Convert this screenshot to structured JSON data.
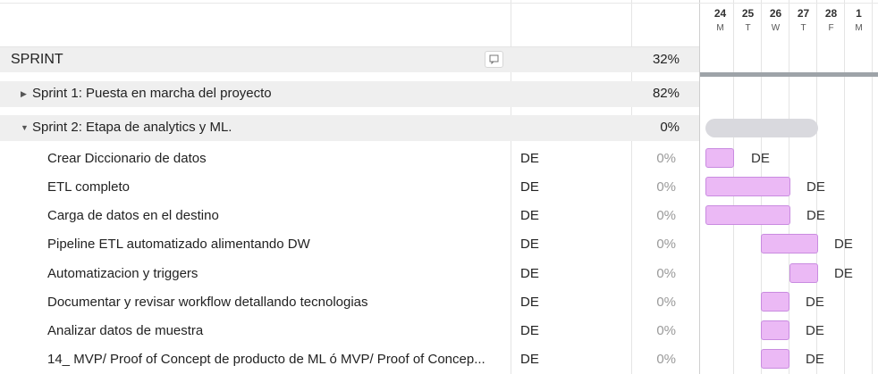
{
  "timeline": {
    "days": [
      {
        "num": "24",
        "dow": "M"
      },
      {
        "num": "25",
        "dow": "T"
      },
      {
        "num": "26",
        "dow": "W"
      },
      {
        "num": "27",
        "dow": "T"
      },
      {
        "num": "28",
        "dow": "F"
      },
      {
        "num": "1",
        "dow": "M"
      }
    ]
  },
  "group": {
    "title": "SPRINT",
    "percent": "32%"
  },
  "sprints": [
    {
      "title": "Sprint 1: Puesta en marcha del proyecto",
      "percent": "82%",
      "expanded": false,
      "toggle": "▶"
    },
    {
      "title": "Sprint 2: Etapa de analytics y ML.",
      "percent": "0%",
      "expanded": true,
      "toggle": "▼"
    }
  ],
  "tasks": [
    {
      "name": "Crear Diccionario de datos",
      "assignee": "DE",
      "percent": "0%",
      "bar_label": "DE"
    },
    {
      "name": "ETL completo",
      "assignee": "DE",
      "percent": "0%",
      "bar_label": "DE"
    },
    {
      "name": "Carga de datos en el destino",
      "assignee": "DE",
      "percent": "0%",
      "bar_label": "DE"
    },
    {
      "name": "Pipeline ETL automatizado alimentando DW",
      "assignee": "DE",
      "percent": "0%",
      "bar_label": "DE"
    },
    {
      "name": "Automatizacion y triggers",
      "assignee": "DE",
      "percent": "0%",
      "bar_label": "DE"
    },
    {
      "name": "Documentar y revisar workflow detallando tecnologias",
      "assignee": "DE",
      "percent": "0%",
      "bar_label": "DE"
    },
    {
      "name": "Analizar datos de muestra",
      "assignee": "DE",
      "percent": "0%",
      "bar_label": "DE"
    },
    {
      "name": "14_ MVP/ Proof of Concept de producto de ML ó MVP/ Proof of Concep...",
      "assignee": "DE",
      "percent": "0%",
      "bar_label": "DE"
    }
  ],
  "colors": {
    "task_bar_fill": "#ebb9f5",
    "task_bar_border": "#c98be0",
    "summary_bar": "#d9d9de",
    "group_bar": "#9ea3a8",
    "row_band": "#efefef"
  }
}
